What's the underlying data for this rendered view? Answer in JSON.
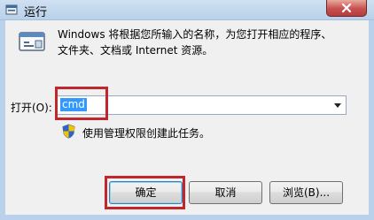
{
  "window": {
    "title": "运行"
  },
  "description": {
    "line1": "Windows 将根据您所输入的名称，为您打开相应的程序、",
    "line2": "文件夹、文档或 Internet 资源。"
  },
  "open": {
    "label": "打开(O):",
    "value": "cmd"
  },
  "admin_note": "使用管理权限创建此任务。",
  "buttons": {
    "ok": "确定",
    "cancel": "取消",
    "browse": "浏览(B)..."
  },
  "colors": {
    "highlight": "#c0262c",
    "selection": "#3399ff",
    "close_button": "#c75050"
  },
  "icons": [
    "run-app-icon",
    "close-icon",
    "run-dialog-icon",
    "uac-shield-icon",
    "dropdown-arrow-icon"
  ]
}
